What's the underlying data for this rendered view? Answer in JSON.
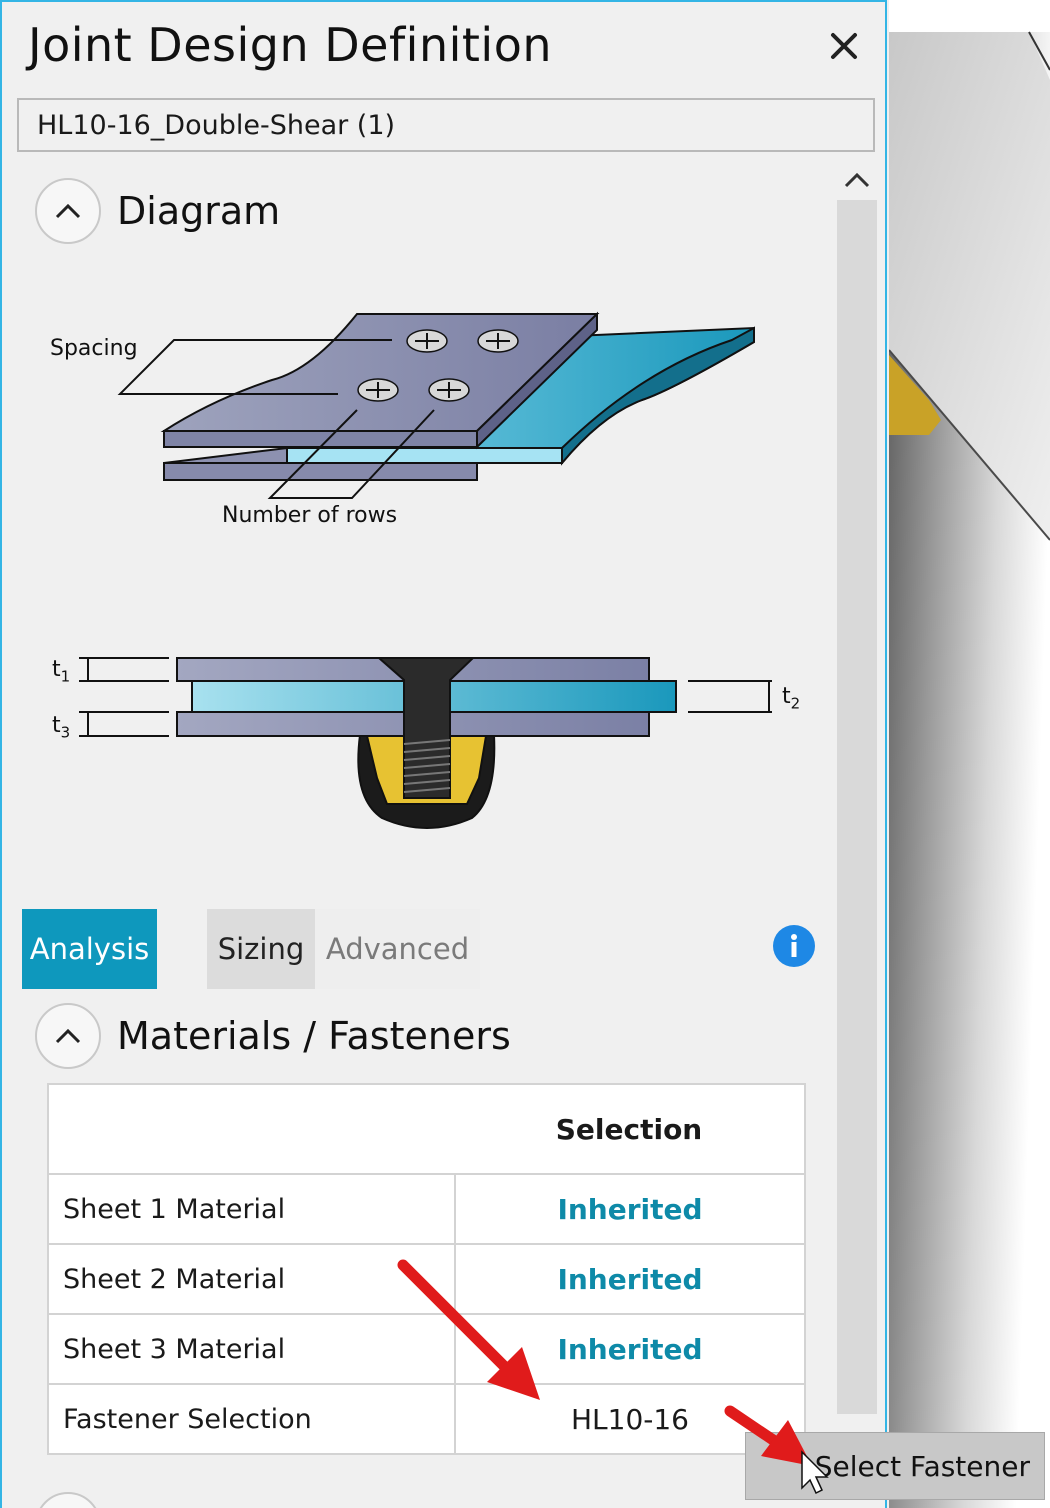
{
  "dialog": {
    "title": "Joint Design Definition",
    "name_value": "HL10-16_Double-Shear (1)"
  },
  "diagram_section": {
    "title": "Diagram",
    "labels": {
      "spacing": "Spacing",
      "rows": "Number of rows",
      "t1": "t",
      "t1_sub": "1",
      "t2": "t",
      "t2_sub": "2",
      "t3": "t",
      "t3_sub": "3"
    }
  },
  "tabs": [
    {
      "label": "Analysis",
      "active": true
    },
    {
      "label": "Sizing",
      "active": false
    },
    {
      "label": "Advanced",
      "active": false
    }
  ],
  "materials_section": {
    "title": "Materials / Fasteners",
    "column_header": "Selection",
    "rows": [
      {
        "label": "Sheet 1 Material",
        "value": "Inherited"
      },
      {
        "label": "Sheet 2 Material",
        "value": "Inherited"
      },
      {
        "label": "Sheet 3 Material",
        "value": "Inherited"
      },
      {
        "label": "Fastener Selection",
        "value": "HL10-16"
      }
    ]
  },
  "tooltip": {
    "text": "Select Fastener"
  },
  "icons": [
    "close-icon",
    "chevron-up-icon",
    "info-icon",
    "mouse-cursor-icon",
    "red-arrow-annotation"
  ],
  "colors": {
    "accent_tab": "#0e98bd",
    "inherited_link": "#0e8aa8",
    "info_icon": "#1e88e5",
    "panel_border": "#33b5e5",
    "annotation_arrow": "#e01b1b"
  }
}
